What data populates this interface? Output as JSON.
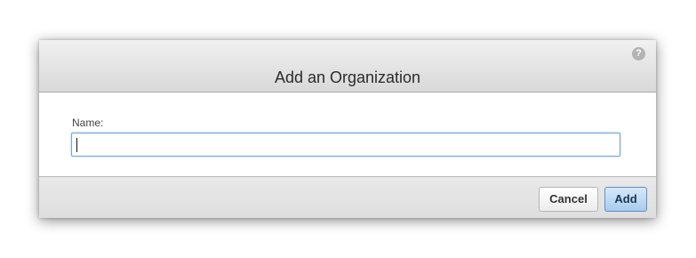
{
  "dialog": {
    "title": "Add an Organization",
    "help_icon": "question-mark-icon",
    "help_glyph": "?"
  },
  "form": {
    "name_label": "Name:",
    "name_value": "",
    "name_placeholder": ""
  },
  "footer": {
    "cancel_label": "Cancel",
    "add_label": "Add"
  },
  "colors": {
    "header_bg": "#e3e3e3",
    "input_focus_border": "#7aa7d6",
    "primary_button_bg": "#a8cbee",
    "help_icon_bg": "#b3b3b3"
  }
}
